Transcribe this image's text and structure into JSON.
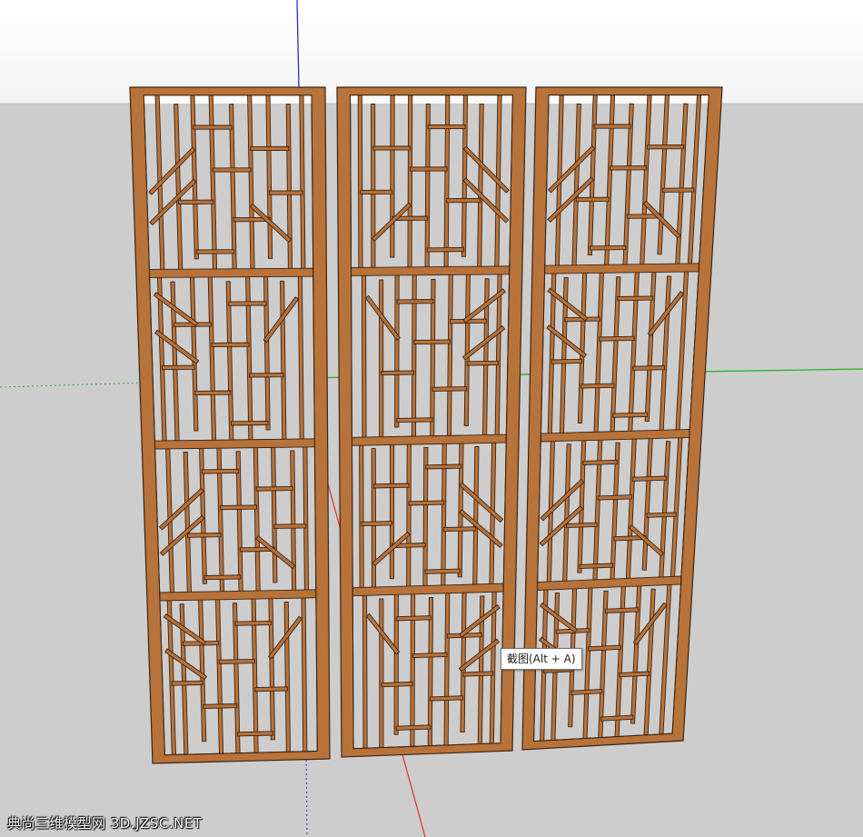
{
  "viewport": {
    "sky_color": "#fdfdfd",
    "ground_color": "#cdcdcd",
    "axis_colors": {
      "blue": "#2b2bd6",
      "red": "#e03030",
      "green": "#22b022"
    }
  },
  "model": {
    "name": "screen-panels",
    "panel_count": 3,
    "wood_color": "#b8733a",
    "wood_edge_color": "#3b2414"
  },
  "tooltip": {
    "label": "截图(Alt + A)"
  },
  "watermark": {
    "text": "典尚三维模型网 3D.JZSC.NET"
  }
}
